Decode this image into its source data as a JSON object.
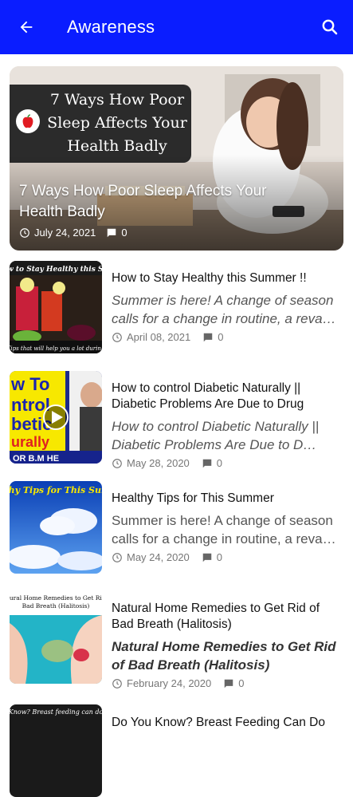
{
  "appbar": {
    "title": "Awareness",
    "back_icon": "arrow-left-icon",
    "search_icon": "search-icon"
  },
  "featured": {
    "image_text": "7 Ways How Poor Sleep Affects Your Health Badly",
    "title": "7 Ways How Poor Sleep Affects Your Health Badly",
    "date": "July 24, 2021",
    "comments": "0"
  },
  "posts": [
    {
      "thumb_text": "How to Stay Healthy this Summer",
      "thumb_caption": "Tips that will help you a lot during",
      "title": "How to Stay Healthy this Summer !!",
      "excerpt": "Summer is here! A change of season calls for a change in routine, a reva…",
      "date": "April 08, 2021",
      "comments": "0"
    },
    {
      "thumb_text": "w To ntrol betic urally",
      "thumb_caption": "OR B.M HE",
      "title": "How to control Diabetic Naturally || Diabetic Problems Are Due to Drug",
      "excerpt": "How to control Diabetic Naturally || Diabetic Problems Are Due to D…",
      "date": "May 28, 2020",
      "comments": "0"
    },
    {
      "thumb_text": "lthy Tips for This Sum",
      "title": "Healthy Tips for This Summer",
      "excerpt": "Summer is here! A change of season calls for a change in routine, a reva…",
      "date": "May 24, 2020",
      "comments": "0"
    },
    {
      "thumb_text": "Natural Home Remedies to Get Rid of Bad Breath (Halitosis)",
      "title": "Natural Home Remedies to Get Rid of Bad Breath (Halitosis)",
      "excerpt": "Natural Home Remedies to Get Rid of Bad Breath (Halitosis)",
      "date": "February 24, 2020",
      "comments": "0"
    },
    {
      "thumb_text": "Know? Breast feeding can do",
      "title": "Do You Know? Breast Feeding Can Do"
    }
  ],
  "colors": {
    "appbar": "#0a1dff",
    "text": "#111111",
    "muted": "#777777"
  }
}
